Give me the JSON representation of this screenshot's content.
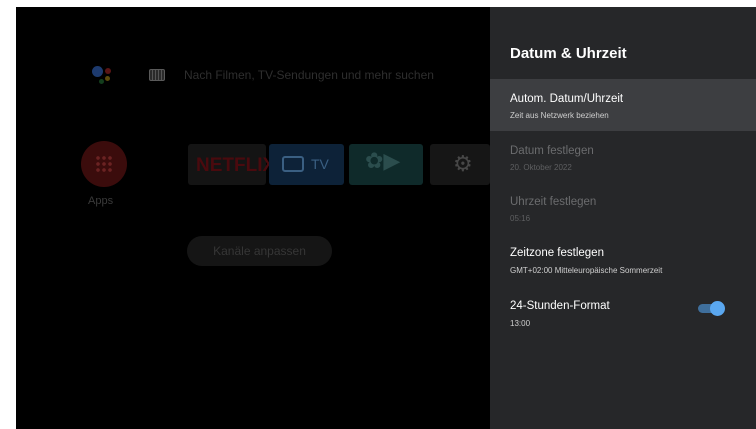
{
  "home": {
    "search_placeholder": "Nach Filmen, TV-Sendungen und mehr suchen",
    "apps_label": "Apps",
    "tiles": {
      "netflix": "NETFLIX",
      "tv": "TV"
    },
    "channels_button": "Kanäle anpassen"
  },
  "panel": {
    "title": "Datum & Uhrzeit",
    "items": [
      {
        "title": "Autom. Datum/Uhrzeit",
        "subtitle": "Zeit aus Netzwerk beziehen",
        "state": "focused"
      },
      {
        "title": "Datum festlegen",
        "subtitle": "20. Oktober 2022",
        "state": "disabled"
      },
      {
        "title": "Uhrzeit festlegen",
        "subtitle": "05:16",
        "state": "disabled"
      },
      {
        "title": "Zeitzone festlegen",
        "subtitle": "GMT+02:00 Mitteleuropäische Sommerzeit",
        "state": "normal"
      },
      {
        "title": "24-Stunden-Format",
        "subtitle": "13:00",
        "state": "normal",
        "toggle_on": true
      }
    ]
  },
  "colors": {
    "panel_bg": "#262729",
    "focused_item_bg": "#3d3e41",
    "toggle_accent": "#5aa7ef"
  }
}
